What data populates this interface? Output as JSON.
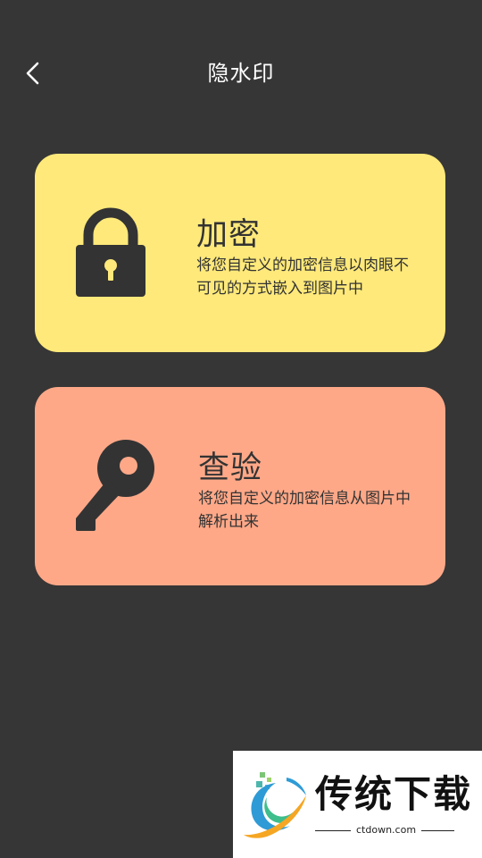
{
  "header": {
    "title": "隐水印",
    "back_icon": "chevron-left-icon"
  },
  "cards": {
    "encrypt": {
      "title": "加密",
      "description": "将您自定义的加密信息以肉眼不可见的方式嵌入到图片中",
      "icon": "lock-icon",
      "color": "#FEE97A"
    },
    "verify": {
      "title": "查验",
      "description": "将您自定义的加密信息从图片中解析出来",
      "icon": "key-icon",
      "color": "#FEA888"
    }
  },
  "watermark": {
    "name": "传统下载",
    "url": "ctdown.com"
  },
  "colors": {
    "background": "#363636",
    "icon": "#333333",
    "text": "#333333"
  }
}
